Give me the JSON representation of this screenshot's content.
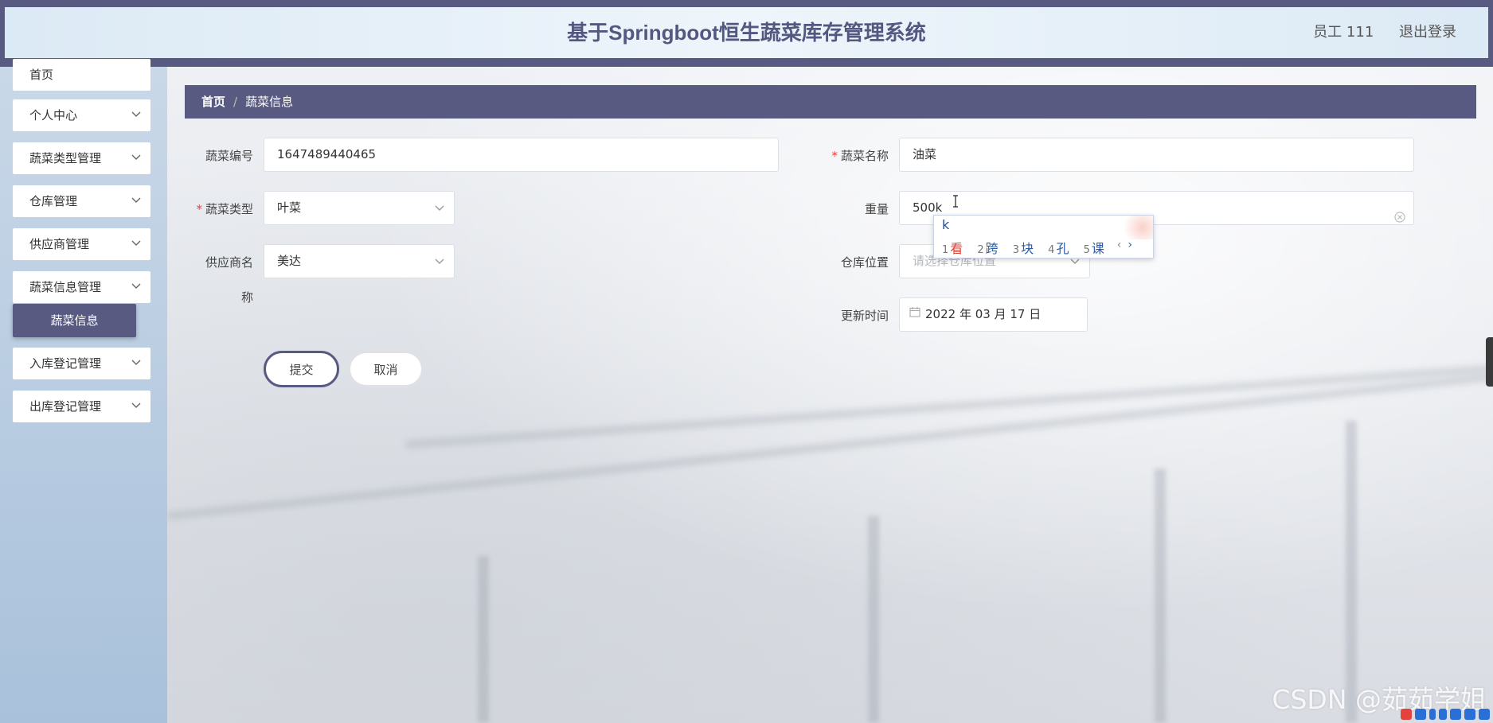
{
  "header": {
    "title": "基于Springboot恒生蔬菜库存管理系统",
    "user": "员工 111",
    "logout": "退出登录"
  },
  "sidebar": {
    "items": [
      {
        "label": "首页",
        "has_arrow": false
      },
      {
        "label": "个人中心",
        "has_arrow": true
      },
      {
        "label": "蔬菜类型管理",
        "has_arrow": true
      },
      {
        "label": "仓库管理",
        "has_arrow": true
      },
      {
        "label": "供应商管理",
        "has_arrow": true
      },
      {
        "label": "蔬菜信息管理",
        "has_arrow": true,
        "expanded": true
      },
      {
        "label": "入库登记管理",
        "has_arrow": true
      },
      {
        "label": "出库登记管理",
        "has_arrow": true
      }
    ],
    "active_sub": "蔬菜信息"
  },
  "breadcrumb": {
    "home": "首页",
    "separator": "/",
    "current": "蔬菜信息"
  },
  "form": {
    "code": {
      "label": "蔬菜编号",
      "value": "1647489440465",
      "required": false
    },
    "name": {
      "label": "蔬菜名称",
      "value": "油菜",
      "required": true
    },
    "type": {
      "label": "蔬菜类型",
      "value": "叶菜",
      "required": true
    },
    "weight": {
      "label": "重量",
      "value": "500k",
      "required": false
    },
    "supplier": {
      "label_line1": "供应商名",
      "label_line2": "称",
      "value": "美达",
      "required": false
    },
    "warehouse": {
      "label": "仓库位置",
      "placeholder": "请选择仓库位置",
      "required": false
    },
    "updated": {
      "label": "更新时间",
      "value": "2022 年 03 月 17 日",
      "required": false
    },
    "required_mark": "*"
  },
  "buttons": {
    "submit": "提交",
    "cancel": "取消"
  },
  "ime": {
    "input": "k",
    "candidates": [
      {
        "num": "1",
        "text": "看"
      },
      {
        "num": "2",
        "text": "跨"
      },
      {
        "num": "3",
        "text": "块"
      },
      {
        "num": "4",
        "text": "孔"
      },
      {
        "num": "5",
        "text": "课"
      }
    ],
    "prev": "‹",
    "next": "›"
  },
  "watermark": "CSDN @茹茹学姐",
  "colors": {
    "accent": "#585a82",
    "required": "#e4433d",
    "title": "#545880"
  }
}
